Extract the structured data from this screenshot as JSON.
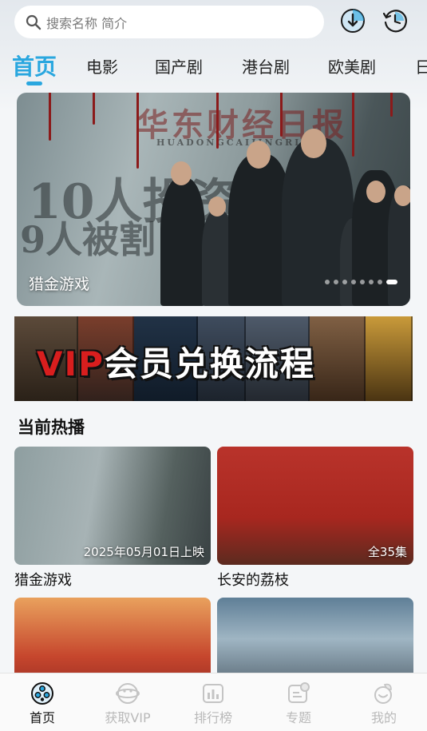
{
  "search": {
    "placeholder": "搜索名称 简介"
  },
  "tabs": [
    "首页",
    "电影",
    "国产剧",
    "港台剧",
    "欧美剧",
    "日"
  ],
  "hero": {
    "title": "猎金游戏",
    "dots_total": 8,
    "active_dot": 7,
    "poster_text": [
      "华东财经日报",
      "HUADONGCAIJINGRIBAO",
      "10人投资",
      "9人被割"
    ]
  },
  "vip_banner": {
    "text_red": "VIP",
    "text_white": "会员兑换流程"
  },
  "section": {
    "title": "当前热播"
  },
  "cards": [
    {
      "name": "猎金游戏",
      "badge": "2025年05月01日上映"
    },
    {
      "name": "长安的荔枝",
      "badge": "全35集"
    },
    {
      "name": "",
      "badge": ""
    },
    {
      "name": "",
      "badge": ""
    }
  ],
  "bottom_nav": [
    {
      "label": "首页",
      "icon": "home-icon",
      "active": true
    },
    {
      "label": "获取VIP",
      "icon": "vip-icon",
      "active": false
    },
    {
      "label": "排行榜",
      "icon": "ranking-icon",
      "active": false
    },
    {
      "label": "专题",
      "icon": "topic-icon",
      "active": false
    },
    {
      "label": "我的",
      "icon": "profile-icon",
      "active": false
    }
  ],
  "colors": {
    "accent": "#2aa7df",
    "inactive": "#b9b9b9",
    "vip_red": "#d81e1e"
  }
}
